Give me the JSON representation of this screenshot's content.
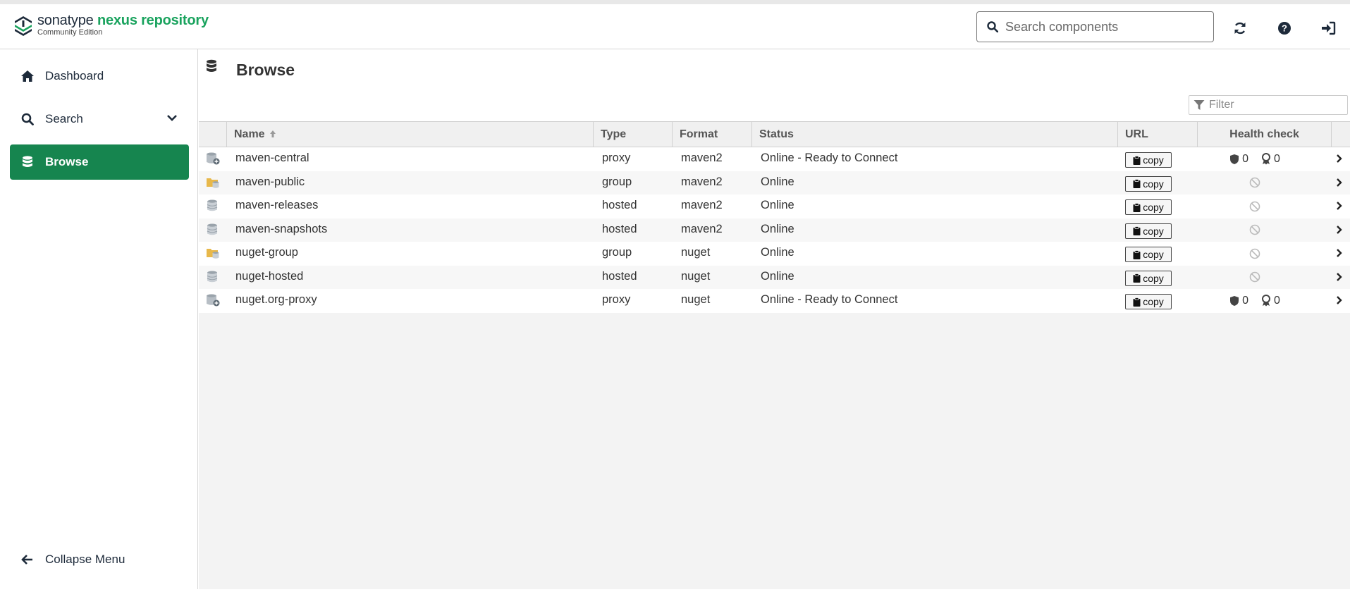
{
  "header": {
    "brand_prefix": "sonatype ",
    "brand_product": "nexus repository",
    "edition": "Community Edition",
    "search_placeholder": "Search components"
  },
  "sidebar": {
    "items": [
      {
        "label": "Dashboard",
        "icon": "home-icon"
      },
      {
        "label": "Search",
        "icon": "search-icon"
      },
      {
        "label": "Browse",
        "icon": "database-icon",
        "active": true
      }
    ],
    "collapse_label": "Collapse Menu"
  },
  "main": {
    "title": "Browse",
    "filter_placeholder": "Filter",
    "columns": {
      "name": "Name",
      "type": "Type",
      "format": "Format",
      "status": "Status",
      "url": "URL",
      "health": "Health check"
    },
    "copy_label": "copy",
    "rows": [
      {
        "name": "maven-central",
        "type": "proxy",
        "format": "maven2",
        "status": "Online - Ready to Connect",
        "security": "0",
        "license": "0"
      },
      {
        "name": "maven-public",
        "type": "group",
        "format": "maven2",
        "status": "Online"
      },
      {
        "name": "maven-releases",
        "type": "hosted",
        "format": "maven2",
        "status": "Online"
      },
      {
        "name": "maven-snapshots",
        "type": "hosted",
        "format": "maven2",
        "status": "Online"
      },
      {
        "name": "nuget-group",
        "type": "group",
        "format": "nuget",
        "status": "Online"
      },
      {
        "name": "nuget-hosted",
        "type": "hosted",
        "format": "nuget",
        "status": "Online"
      },
      {
        "name": "nuget.org-proxy",
        "type": "proxy",
        "format": "nuget",
        "status": "Online - Ready to Connect",
        "security": "0",
        "license": "0"
      }
    ]
  },
  "colors": {
    "brand_green": "#1aa35e",
    "active_nav": "#16854f",
    "group_folder": "#e8b84a"
  }
}
